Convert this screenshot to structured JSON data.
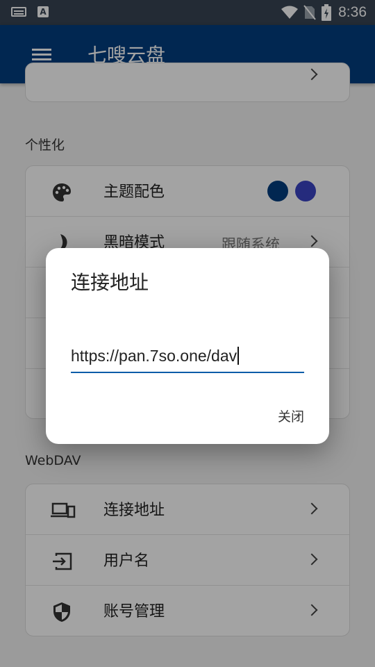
{
  "status_bar": {
    "time": "8:36"
  },
  "app_bar": {
    "title": "七嗖云盘"
  },
  "sections": {
    "personalize_title": "个性化",
    "theme_label": "主题配色",
    "theme_colors": [
      "#033e7f",
      "#3b44c4"
    ],
    "dark_mode_label": "黑暗模式",
    "dark_mode_value": "跟随系统",
    "webdav_title": "WebDAV",
    "webdav_items": [
      {
        "label": "连接地址",
        "icon": "devices-icon"
      },
      {
        "label": "用户名",
        "icon": "login-icon"
      },
      {
        "label": "账号管理",
        "icon": "shield-icon"
      }
    ]
  },
  "dialog": {
    "title": "连接地址",
    "input_value": "https://pan.7so.one/dav",
    "close_label": "关闭"
  },
  "colors": {
    "primary": "#033e7f",
    "accent": "#0a5ca8",
    "statusbar": "#374453"
  }
}
